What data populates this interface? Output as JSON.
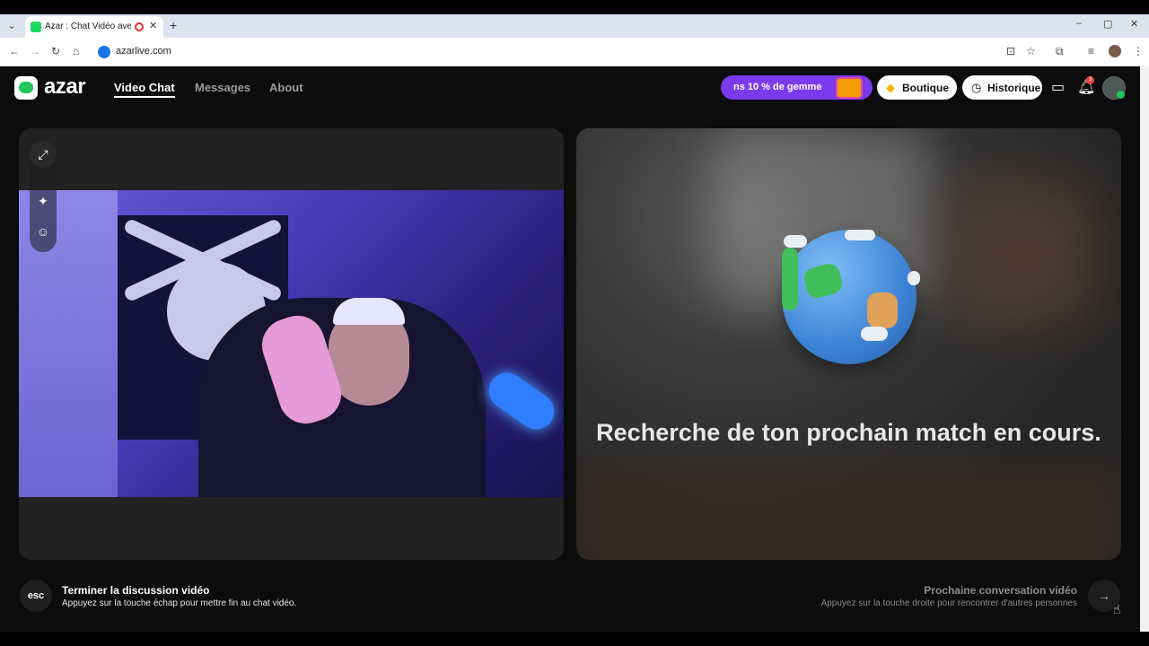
{
  "browser": {
    "tab_title": "Azar : Chat Vidéo avec de n",
    "url": "azarlive.com",
    "tab_close": "✕",
    "new_tab": "+",
    "window_controls": [
      "–",
      "▢",
      "✕"
    ],
    "icons": {
      "tab_list": "chevron-down-icon",
      "back": "back-arrow-icon",
      "forward": "forward-arrow-icon",
      "reload": "reload-icon",
      "home": "home-icon",
      "install": "install-app-icon",
      "bookmark": "star-icon",
      "extensions": "puzzle-icon",
      "media": "media-control-icon",
      "menu": "kebab-menu-icon"
    }
  },
  "header": {
    "logo_text": "azar",
    "nav": [
      {
        "label": "Video Chat",
        "active": true
      },
      {
        "label": "Messages",
        "active": false
      },
      {
        "label": "About",
        "active": false
      }
    ],
    "promo_text": "ns 10 % de gemme",
    "boutique_label": "Boutique",
    "historique_label": "Historique",
    "notification_count": "3",
    "colors": {
      "promo": "#7c3aed",
      "accent": "#22c55e"
    }
  },
  "main": {
    "search_text": "Recherche de ton prochain match en cours."
  },
  "footer": {
    "esc_label": "esc",
    "end_title": "Terminer la discussion vidéo",
    "end_sub": "Appuyez sur la touche échap pour mettre fin au chat vidéo.",
    "next_title": "Prochaine conversation vidéo",
    "next_sub": "Appuyez sur la touche droite pour rencontrer d'autres personnes"
  }
}
